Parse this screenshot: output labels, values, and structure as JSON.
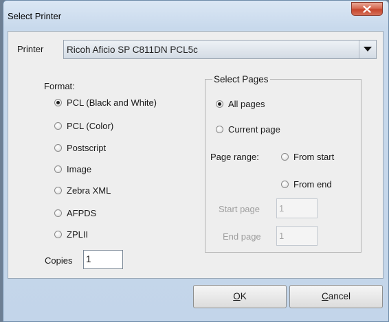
{
  "window": {
    "title": "Select Printer"
  },
  "printer": {
    "label": "Printer",
    "selected": "Ricoh Aficio SP C811DN PCL5c"
  },
  "format": {
    "label": "Format:",
    "options": [
      {
        "label": "PCL (Black and White)",
        "checked": true
      },
      {
        "label": "PCL (Color)",
        "checked": false
      },
      {
        "label": "Postscript",
        "checked": false
      },
      {
        "label": "Image",
        "checked": false
      },
      {
        "label": "Zebra XML",
        "checked": false
      },
      {
        "label": "AFPDS",
        "checked": false
      },
      {
        "label": "ZPLII",
        "checked": false
      }
    ]
  },
  "copies": {
    "label": "Copies",
    "value": "1"
  },
  "pages": {
    "group_title": "Select Pages",
    "all_pages": "All pages",
    "current_page": "Current page",
    "range_label": "Page range:",
    "from_start": "From start",
    "from_end": "From end",
    "start_page_label": "Start page",
    "start_page_value": "1",
    "end_page_label": "End page",
    "end_page_value": "1"
  },
  "buttons": {
    "ok_mnemonic": "O",
    "ok_rest": "K",
    "cancel_mnemonic": "C",
    "cancel_rest": "ancel"
  }
}
